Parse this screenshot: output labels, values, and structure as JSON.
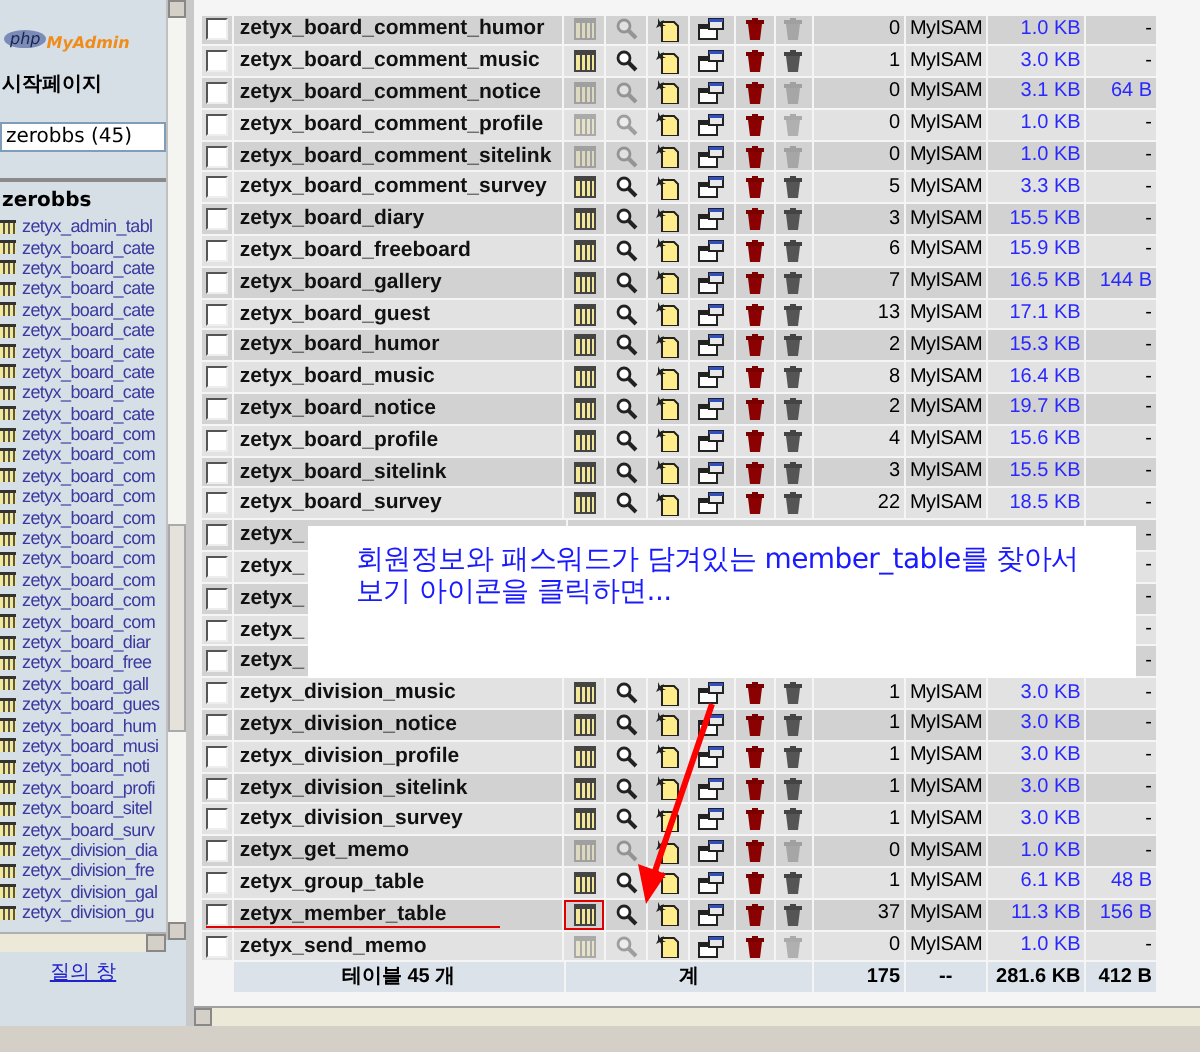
{
  "sidebar": {
    "logo": {
      "mark": "php",
      "name": "MyAdmin"
    },
    "home_link": "시작페이지",
    "database_select": "zerobbs (45)",
    "database_name": "zerobbs",
    "tables": [
      "zetyx_admin_tabl",
      "zetyx_board_cate",
      "zetyx_board_cate",
      "zetyx_board_cate",
      "zetyx_board_cate",
      "zetyx_board_cate",
      "zetyx_board_cate",
      "zetyx_board_cate",
      "zetyx_board_cate",
      "zetyx_board_cate",
      "zetyx_board_com",
      "zetyx_board_com",
      "zetyx_board_com",
      "zetyx_board_com",
      "zetyx_board_com",
      "zetyx_board_com",
      "zetyx_board_com",
      "zetyx_board_com",
      "zetyx_board_com",
      "zetyx_board_com",
      "zetyx_board_diar",
      "zetyx_board_free",
      "zetyx_board_gall",
      "zetyx_board_gues",
      "zetyx_board_hum",
      "zetyx_board_musi",
      "zetyx_board_noti",
      "zetyx_board_profi",
      "zetyx_board_sitel",
      "zetyx_board_surv",
      "zetyx_division_dia",
      "zetyx_division_fre",
      "zetyx_division_gal",
      "zetyx_division_gu"
    ],
    "query_window_link": "질의 창"
  },
  "table": {
    "rows": [
      {
        "kind": "full",
        "checked": false,
        "name": "zetyx_board_comment_humor",
        "empty": true,
        "rows": "0",
        "type": "MyISAM",
        "size": "1.0 KB",
        "overhead": "-",
        "highlighted": false
      },
      {
        "kind": "full",
        "checked": false,
        "name": "zetyx_board_comment_music",
        "empty": false,
        "rows": "1",
        "type": "MyISAM",
        "size": "3.0 KB",
        "overhead": "-",
        "highlighted": false
      },
      {
        "kind": "full",
        "checked": false,
        "name": "zetyx_board_comment_notice",
        "empty": true,
        "rows": "0",
        "type": "MyISAM",
        "size": "3.1 KB",
        "overhead": "64 B",
        "highlighted": false
      },
      {
        "kind": "full",
        "checked": false,
        "name": "zetyx_board_comment_profile",
        "empty": true,
        "rows": "0",
        "type": "MyISAM",
        "size": "1.0 KB",
        "overhead": "-",
        "highlighted": false
      },
      {
        "kind": "full",
        "checked": false,
        "name": "zetyx_board_comment_sitelink",
        "empty": true,
        "rows": "0",
        "type": "MyISAM",
        "size": "1.0 KB",
        "overhead": "-",
        "highlighted": false
      },
      {
        "kind": "full",
        "checked": false,
        "name": "zetyx_board_comment_survey",
        "empty": false,
        "rows": "5",
        "type": "MyISAM",
        "size": "3.3 KB",
        "overhead": "-",
        "highlighted": false
      },
      {
        "kind": "full",
        "checked": false,
        "name": "zetyx_board_diary",
        "empty": false,
        "rows": "3",
        "type": "MyISAM",
        "size": "15.5 KB",
        "overhead": "-",
        "highlighted": false
      },
      {
        "kind": "full",
        "checked": false,
        "name": "zetyx_board_freeboard",
        "empty": false,
        "rows": "6",
        "type": "MyISAM",
        "size": "15.9 KB",
        "overhead": "-",
        "highlighted": false
      },
      {
        "kind": "full",
        "checked": false,
        "name": "zetyx_board_gallery",
        "empty": false,
        "rows": "7",
        "type": "MyISAM",
        "size": "16.5 KB",
        "overhead": "144 B",
        "highlighted": false
      },
      {
        "kind": "full",
        "checked": false,
        "name": "zetyx_board_guest",
        "empty": false,
        "rows": "13",
        "type": "MyISAM",
        "size": "17.1 KB",
        "overhead": "-",
        "highlighted": false
      },
      {
        "kind": "full",
        "checked": false,
        "name": "zetyx_board_humor",
        "empty": false,
        "rows": "2",
        "type": "MyISAM",
        "size": "15.3 KB",
        "overhead": "-",
        "highlighted": false
      },
      {
        "kind": "full",
        "checked": false,
        "name": "zetyx_board_music",
        "empty": false,
        "rows": "8",
        "type": "MyISAM",
        "size": "16.4 KB",
        "overhead": "-",
        "highlighted": false
      },
      {
        "kind": "full",
        "checked": false,
        "name": "zetyx_board_notice",
        "empty": false,
        "rows": "2",
        "type": "MyISAM",
        "size": "19.7 KB",
        "overhead": "-",
        "highlighted": false
      },
      {
        "kind": "full",
        "checked": false,
        "name": "zetyx_board_profile",
        "empty": false,
        "rows": "4",
        "type": "MyISAM",
        "size": "15.6 KB",
        "overhead": "-",
        "highlighted": false
      },
      {
        "kind": "full",
        "checked": false,
        "name": "zetyx_board_sitelink",
        "empty": false,
        "rows": "3",
        "type": "MyISAM",
        "size": "15.5 KB",
        "overhead": "-",
        "highlighted": false
      },
      {
        "kind": "full",
        "checked": false,
        "name": "zetyx_board_survey",
        "empty": false,
        "rows": "22",
        "type": "MyISAM",
        "size": "18.5 KB",
        "overhead": "-",
        "highlighted": false
      },
      {
        "kind": "covered",
        "checked": false,
        "name": "zetyx_",
        "overhead": "-"
      },
      {
        "kind": "covered",
        "checked": false,
        "name": "zetyx_",
        "overhead": "-"
      },
      {
        "kind": "covered",
        "checked": false,
        "name": "zetyx_",
        "overhead": "-"
      },
      {
        "kind": "covered",
        "checked": false,
        "name": "zetyx_",
        "overhead": "-"
      },
      {
        "kind": "covered",
        "checked": false,
        "name": "zetyx_",
        "overhead": "-"
      },
      {
        "kind": "full",
        "checked": false,
        "name": "zetyx_division_music",
        "empty": false,
        "rows": "1",
        "type": "MyISAM",
        "size": "3.0 KB",
        "overhead": "-",
        "highlighted": false
      },
      {
        "kind": "full",
        "checked": false,
        "name": "zetyx_division_notice",
        "empty": false,
        "rows": "1",
        "type": "MyISAM",
        "size": "3.0 KB",
        "overhead": "-",
        "highlighted": false
      },
      {
        "kind": "full",
        "checked": false,
        "name": "zetyx_division_profile",
        "empty": false,
        "rows": "1",
        "type": "MyISAM",
        "size": "3.0 KB",
        "overhead": "-",
        "highlighted": false
      },
      {
        "kind": "full",
        "checked": false,
        "name": "zetyx_division_sitelink",
        "empty": false,
        "rows": "1",
        "type": "MyISAM",
        "size": "3.0 KB",
        "overhead": "-",
        "highlighted": false
      },
      {
        "kind": "full",
        "checked": false,
        "name": "zetyx_division_survey",
        "empty": false,
        "rows": "1",
        "type": "MyISAM",
        "size": "3.0 KB",
        "overhead": "-",
        "highlighted": false
      },
      {
        "kind": "full",
        "checked": false,
        "name": "zetyx_get_memo",
        "empty": true,
        "rows": "0",
        "type": "MyISAM",
        "size": "1.0 KB",
        "overhead": "-",
        "highlighted": false
      },
      {
        "kind": "full",
        "checked": false,
        "name": "zetyx_group_table",
        "empty": false,
        "rows": "1",
        "type": "MyISAM",
        "size": "6.1 KB",
        "overhead": "48 B",
        "highlighted": false
      },
      {
        "kind": "full",
        "checked": false,
        "name": "zetyx_member_table",
        "empty": false,
        "rows": "37",
        "type": "MyISAM",
        "size": "11.3 KB",
        "overhead": "156 B",
        "highlighted": true
      },
      {
        "kind": "full",
        "checked": false,
        "name": "zetyx_send_memo",
        "empty": true,
        "rows": "0",
        "type": "MyISAM",
        "size": "1.0 KB",
        "overhead": "-",
        "highlighted": false
      }
    ],
    "footer": {
      "table_count": "테이블 45 개",
      "total_label": "계",
      "rows": "175",
      "type": "--",
      "size": "281.6 KB",
      "overhead": "412 B"
    }
  },
  "callout": {
    "text": "회원정보와 패스워드가 담겨있는 member_table를 찾아서\n보기 아이콘을 클릭하면..."
  }
}
